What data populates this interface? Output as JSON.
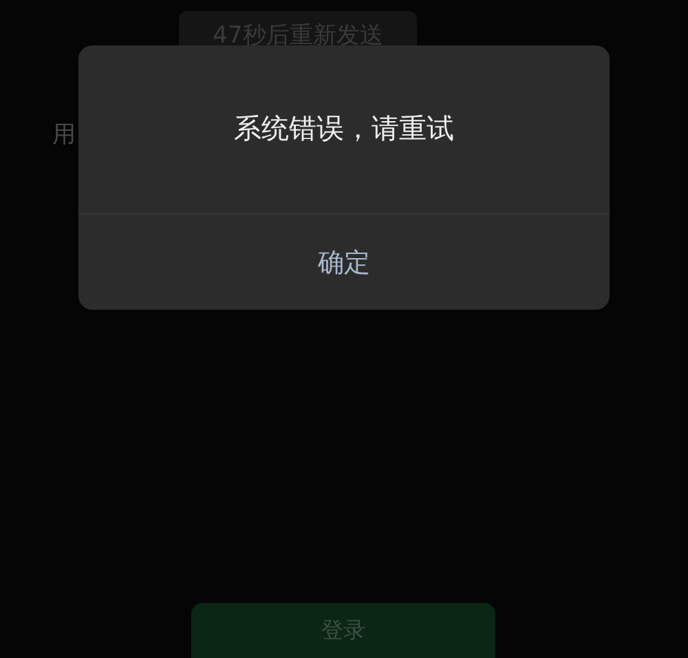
{
  "background": {
    "resend_button": {
      "label": "47秒后重新发送",
      "disabled": true
    },
    "field_label": "用",
    "login_button": {
      "label": "登录"
    }
  },
  "dialog": {
    "message": "系统错误，请重试",
    "buttons": [
      "确定"
    ]
  }
}
